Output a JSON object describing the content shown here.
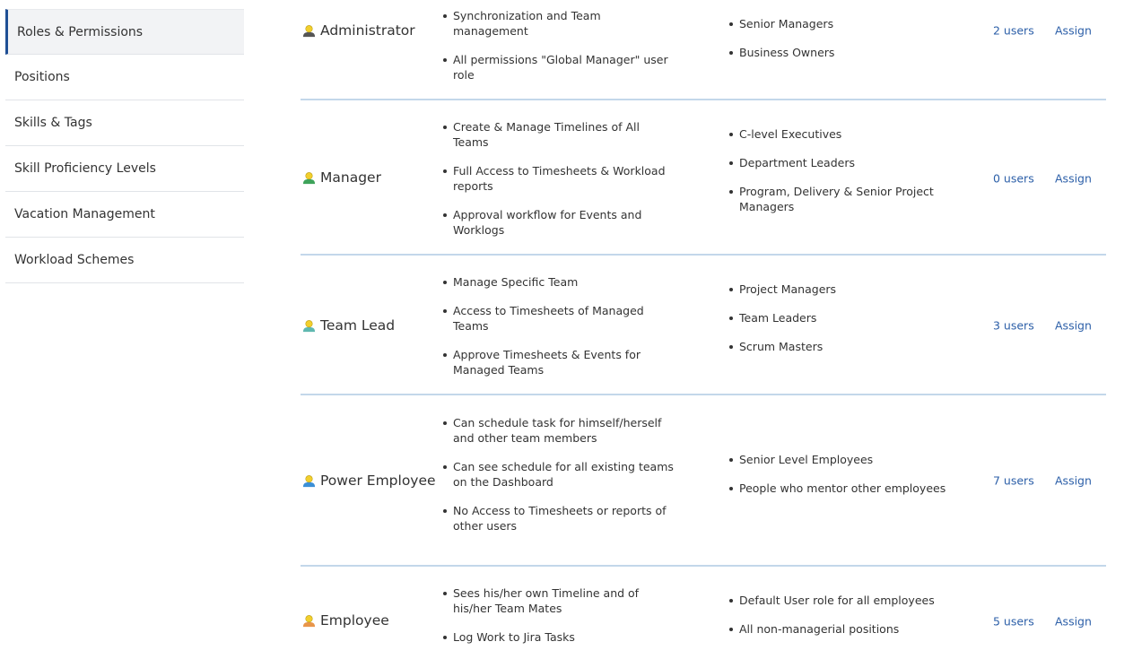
{
  "sidebar": {
    "items": [
      {
        "label": "Roles & Permissions",
        "active": true
      },
      {
        "label": "Positions",
        "active": false
      },
      {
        "label": "Skills & Tags",
        "active": false
      },
      {
        "label": "Skill Proficiency Levels",
        "active": false
      },
      {
        "label": "Vacation Management",
        "active": false
      },
      {
        "label": "Workload Schemes",
        "active": false
      }
    ]
  },
  "roles": [
    {
      "name": "Administrator",
      "icon": "user-icon-admin",
      "icon_body_color": "#555555",
      "permissions": [
        "Synchronization and Team management",
        "All permissions \"Global Manager\" user role"
      ],
      "fits": [
        "Senior Managers",
        "Business Owners"
      ],
      "users_label": "2 users",
      "assign_label": "Assign"
    },
    {
      "name": "Manager",
      "icon": "user-icon-manager",
      "icon_body_color": "#3ea35a",
      "permissions": [
        "Create & Manage Timelines of All Teams",
        "Full Access to Timesheets & Workload reports",
        "Approval workflow for Events and Worklogs"
      ],
      "fits": [
        "C-level Executives",
        "Department Leaders",
        "Program, Delivery & Senior Project Managers"
      ],
      "users_label": "0 users",
      "assign_label": "Assign"
    },
    {
      "name": "Team Lead",
      "icon": "user-icon-team-lead",
      "icon_body_color": "#5fb8b0",
      "permissions": [
        "Manage Specific Team",
        "Access to Timesheets of Managed Teams",
        "Approve Timesheets & Events for Managed Teams"
      ],
      "fits": [
        "Project Managers",
        "Team Leaders",
        "Scrum Masters"
      ],
      "users_label": "3 users",
      "assign_label": "Assign"
    },
    {
      "name": "Power Employee",
      "icon": "user-icon-power-employee",
      "icon_body_color": "#3b8fd6",
      "permissions": [
        "Can schedule task for himself/herself and other team members",
        "Can see schedule for all existing teams on the Dashboard",
        "No Access to Timesheets or reports of other users"
      ],
      "fits": [
        "Senior Level Employees",
        "People who mentor other employees"
      ],
      "users_label": "7 users",
      "assign_label": "Assign"
    },
    {
      "name": "Employee",
      "icon": "user-icon-employee",
      "icon_body_color": "#e8954a",
      "permissions": [
        "Sees his/her own Timeline and of his/her Team Mates",
        "Log Work to Jira Tasks"
      ],
      "fits": [
        "Default User role for all employees",
        "All non-managerial positions"
      ],
      "users_label": "5 users",
      "assign_label": "Assign"
    }
  ]
}
